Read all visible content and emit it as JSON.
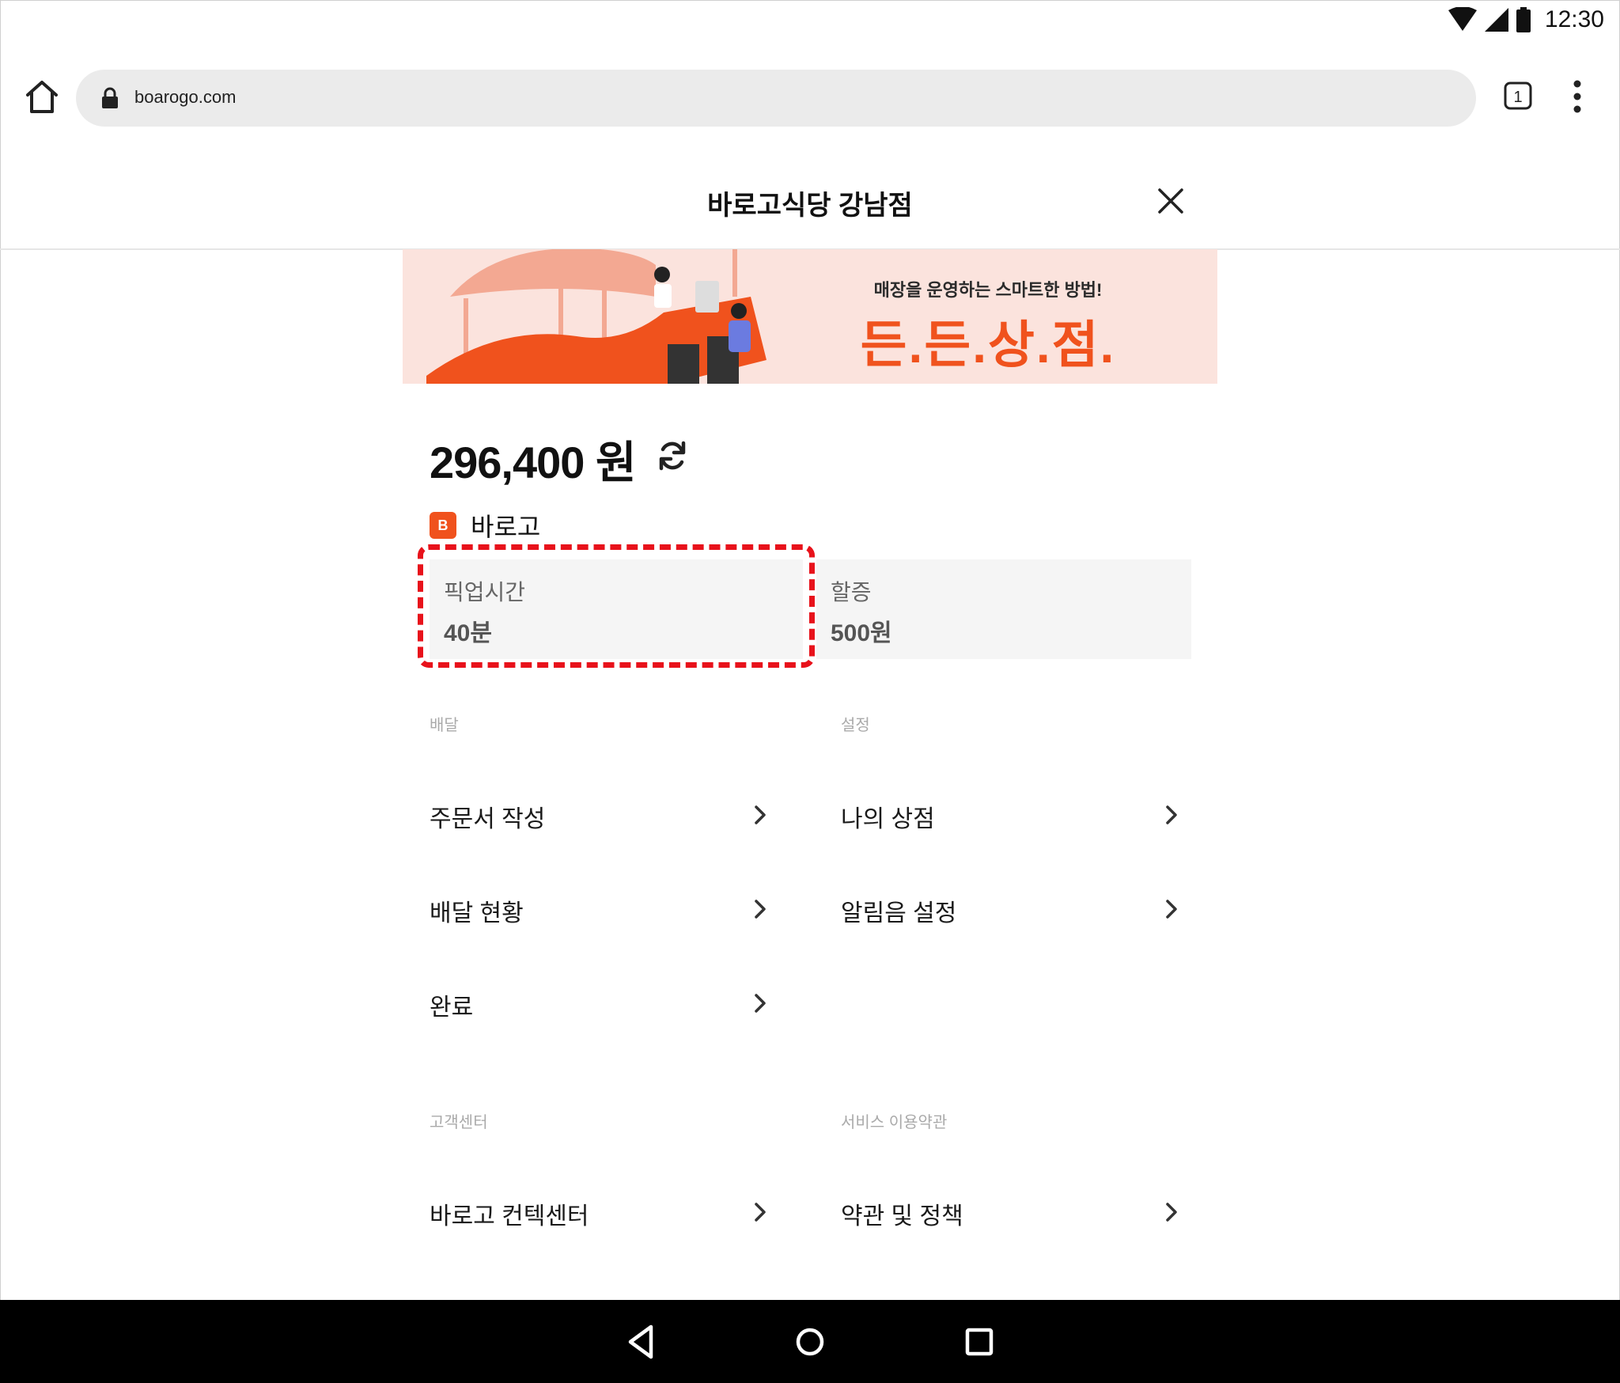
{
  "status_bar": {
    "time": "12:30"
  },
  "browser": {
    "url": "boarogo.com",
    "tab_count": "1"
  },
  "header": {
    "title": "바로고식당 강남점"
  },
  "banner": {
    "subtitle": "매장을 운영하는 스마트한 방법!",
    "headline": "든.든.상.점."
  },
  "balance": {
    "amount": "296,400 원"
  },
  "brand": {
    "name": "바로고",
    "logo_text": "B"
  },
  "info": {
    "pickup": {
      "label": "픽업시간",
      "value": "40분"
    },
    "surcharge": {
      "label": "할증",
      "value": "500원"
    }
  },
  "sections": {
    "delivery": {
      "label": "배달",
      "items": [
        "주문서 작성",
        "배달 현황",
        "완료"
      ]
    },
    "settings": {
      "label": "설정",
      "items": [
        "나의 상점",
        "알림음 설정"
      ]
    },
    "support": {
      "label": "고객센터",
      "items": [
        "바로고 컨텍센터"
      ]
    },
    "terms": {
      "label": "서비스 이용약관",
      "items": [
        "약관 및 정책"
      ]
    }
  },
  "colors": {
    "brand_orange": "#f0521d",
    "banner_bg": "#fbe3dd",
    "highlight_red": "#e8121b"
  }
}
